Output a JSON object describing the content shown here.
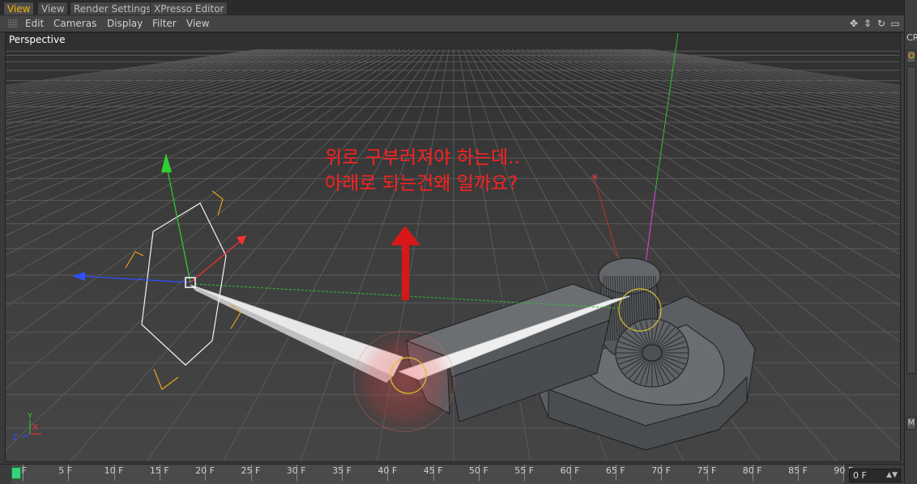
{
  "tabs": [
    {
      "label": "View",
      "active": true
    },
    {
      "label": "View",
      "active": false
    },
    {
      "label": "Render Settings",
      "active": false
    },
    {
      "label": "XPresso Editor",
      "active": false
    }
  ],
  "menu": [
    "Edit",
    "Cameras",
    "Display",
    "Filter",
    "View"
  ],
  "viewport": {
    "label": "Perspective",
    "annotation_lines": [
      "위로 구부러져야 하는데..",
      "아래로 되는건왜 일까요?"
    ]
  },
  "right_strip": {
    "top_text": "CR",
    "tab_o": "O",
    "tab_m": "M"
  },
  "timeline": {
    "ticks": [
      "0 F",
      "5 F",
      "10 F",
      "15 F",
      "20 F",
      "25 F",
      "30 F",
      "35 F",
      "40 F",
      "45 F",
      "50 F",
      "55 F",
      "60 F",
      "65 F",
      "70 F",
      "75 F",
      "80 F",
      "85 F",
      "90 F"
    ],
    "current_frame": "0 F"
  },
  "colors": {
    "accent_tab": "#f5b400",
    "annotation": "#ff2020",
    "axis_x": "#ff3030",
    "axis_y": "#30d030",
    "axis_z": "#3050ff"
  }
}
